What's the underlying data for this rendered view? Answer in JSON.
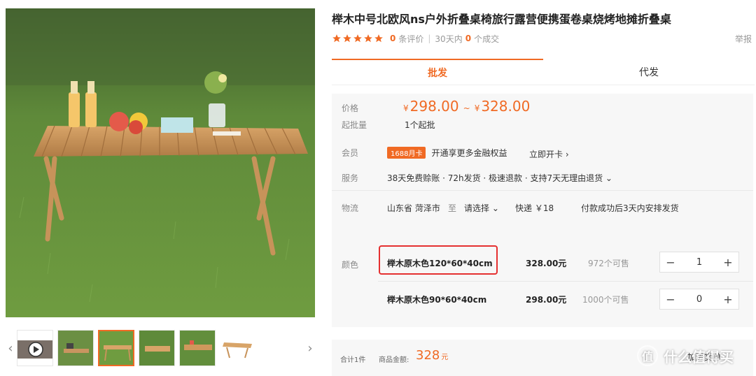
{
  "product": {
    "title": "榉木中号北欧风ns户外折叠桌椅旅行露营便携蛋卷桌烧烤地摊折叠桌",
    "reviews_count": "0",
    "reviews_label": "条评价",
    "sales_prefix": "30天内",
    "sales_count": "0",
    "sales_label": "个成交",
    "report": "举报"
  },
  "tabs": [
    "批发",
    "代发"
  ],
  "price": {
    "label": "价格",
    "yen": "¥",
    "low": "298.00",
    "tilde": "~",
    "high": "328.00",
    "moq_label": "起批量",
    "moq": "1个起批"
  },
  "member": {
    "label": "会员",
    "badge": "1688月卡",
    "text": "开通享更多金融权益",
    "action": "立即开卡 ›"
  },
  "service": {
    "label": "服务",
    "text": "38天免费赊账 · 72h发货 · 极速退款 · 支持7天无理由退货 ⌄"
  },
  "logistics": {
    "label": "物流",
    "origin": "山东省 菏泽市",
    "to": "至",
    "destination": "请选择 ⌄",
    "express": "快递 ￥18",
    "ship_note": "付款成功后3天内安排发货"
  },
  "colors": {
    "label": "颜色",
    "options": [
      {
        "name": "榉木原木色120*60*40cm",
        "price": "328.00元",
        "stock": "972个可售",
        "qty": "1"
      },
      {
        "name": "榉木原木色90*60*40cm",
        "price": "298.00元",
        "stock": "1000个可售",
        "qty": "0"
      }
    ]
  },
  "summary": {
    "count": "合计1件",
    "amount_label": "商品金额:",
    "amount": "328",
    "unit": "元",
    "cart": "加进货单"
  },
  "watermark": "什么值得买",
  "accent": "#f06a24",
  "highlight_color": "#e53030"
}
